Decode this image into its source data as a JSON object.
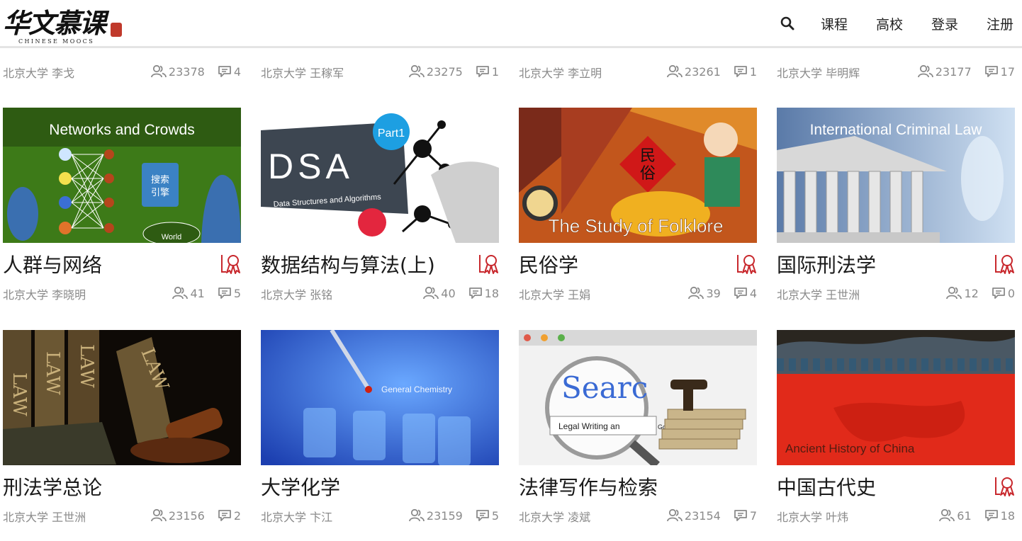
{
  "header": {
    "logo_main": "华文慕课",
    "logo_sub": "CHINESE MOOCS",
    "nav": [
      "课程",
      "高校",
      "登录",
      "注册"
    ]
  },
  "top_row": [
    {
      "org": "北京大学 李戈",
      "students": "23378",
      "comments": "4"
    },
    {
      "org": "北京大学 王稼军",
      "students": "23275",
      "comments": "1"
    },
    {
      "org": "北京大学 李立明",
      "students": "23261",
      "comments": "1"
    },
    {
      "org": "北京大学 毕明辉",
      "students": "23177",
      "comments": "17"
    }
  ],
  "courses": [
    {
      "title": "人群与网络",
      "org": "北京大学 李晓明",
      "students": "41",
      "comments": "5",
      "certified": true,
      "thumb_text": "Networks and Crowds",
      "thumb_extra": [
        "搜索",
        "引擎",
        "World"
      ]
    },
    {
      "title": "数据结构与算法(上)",
      "org": "北京大学 张铭",
      "students": "40",
      "comments": "18",
      "certified": true,
      "thumb_text": "DSA",
      "thumb_extra": [
        "Part1",
        "Data Structures and Algorithms"
      ]
    },
    {
      "title": "民俗学",
      "org": "北京大学 王娟",
      "students": "39",
      "comments": "4",
      "certified": true,
      "thumb_text": "The Study of Folklore",
      "thumb_extra": [
        "民",
        "俗"
      ]
    },
    {
      "title": "国际刑法学",
      "org": "北京大学 王世洲",
      "students": "12",
      "comments": "0",
      "certified": true,
      "thumb_text": "International Criminal Law",
      "thumb_extra": []
    },
    {
      "title": "刑法学总论",
      "org": "北京大学 王世洲",
      "students": "23156",
      "comments": "2",
      "certified": false,
      "thumb_text": "LAW",
      "thumb_extra": []
    },
    {
      "title": "大学化学",
      "org": "北京大学 卞江",
      "students": "23159",
      "comments": "5",
      "certified": false,
      "thumb_text": "General Chemistry",
      "thumb_extra": []
    },
    {
      "title": "法律写作与检索",
      "org": "北京大学 凌斌",
      "students": "23154",
      "comments": "7",
      "certified": false,
      "thumb_text": "Searc",
      "thumb_extra": [
        "Legal Writing an",
        "Go"
      ]
    },
    {
      "title": "中国古代史",
      "org": "北京大学 叶炜",
      "students": "61",
      "comments": "18",
      "certified": true,
      "thumb_text": "Ancient History of China",
      "thumb_extra": []
    }
  ],
  "icons": {
    "students": "people-icon",
    "comments": "comment-icon",
    "certificate": "certificate-ribbon-icon",
    "search": "search-icon"
  },
  "colors": {
    "accent_red": "#c8282d",
    "meta_gray": "#8a8a8a"
  }
}
